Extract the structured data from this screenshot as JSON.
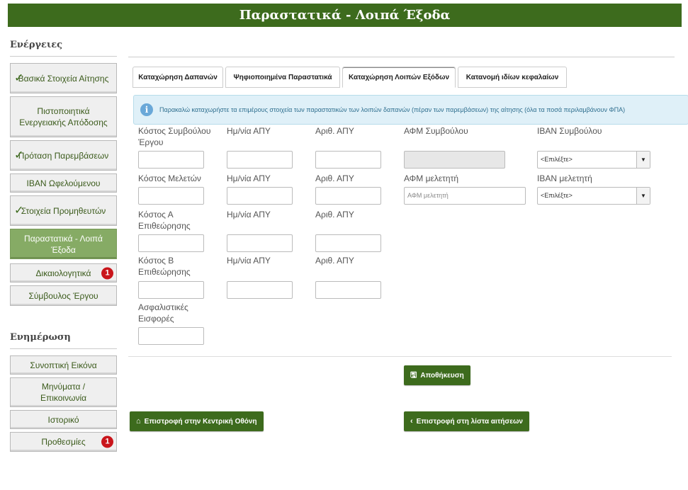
{
  "header": {
    "title": "Παραστατικά - Λοιπά Έξοδα"
  },
  "sidebar": {
    "actions_title": "Ενέργειες",
    "actions": [
      {
        "label": "Βασικά Στοιχεία Αίτησης",
        "checked": true
      },
      {
        "label": "Πιστοποιητικά Ενεργειακής Απόδοσης",
        "checked": false
      },
      {
        "label": "Πρόταση Παρεμβάσεων",
        "checked": true
      },
      {
        "label": "IBAN Ωφελούμενου",
        "checked": false
      },
      {
        "label": "Στοιχεία Προμηθευτών",
        "checked": true
      },
      {
        "label": "Παραστατικά - Λοιπά Έξοδα",
        "active": true
      },
      {
        "label": "Δικαιολογητικά",
        "badge": "1"
      },
      {
        "label": "Σύμβουλος Έργου"
      }
    ],
    "info_title": "Ενημέρωση",
    "info": [
      {
        "label": "Συνοπτική Εικόνα"
      },
      {
        "label": "Μηνύματα / Επικοινωνία"
      },
      {
        "label": "Ιστορικό"
      },
      {
        "label": "Προθεσμίες",
        "badge": "1"
      }
    ]
  },
  "tabs": [
    {
      "label": "Καταχώρηση Δαπανών"
    },
    {
      "label": "Ψηφιοποιημένα Παραστατικά"
    },
    {
      "label": "Καταχώρηση Λοιπών Εξόδων",
      "active": true
    },
    {
      "label": "Κατανομή ιδίων κεφαλαίων"
    }
  ],
  "info_box": {
    "icon": "info-icon",
    "text": "Παρακαλώ καταχωρήστε τα επιμέρους στοιχεία των παραστατικών των λοιπών δαπανών (πέραν των παρεμβάσεων) της αίτησης (όλα τα ποσά περιλαμβάνουν ΦΠΑ)"
  },
  "form": {
    "row1": {
      "cost": "Κόστος Συμβούλου Έργου",
      "date": "Ημ/νία ΑΠΥ",
      "num": "Αριθ. ΑΠΥ",
      "afm": "ΑΦΜ Συμβούλου",
      "iban": "IBAN Συμβούλου",
      "iban_value": "<Επιλέξτε>"
    },
    "row2": {
      "cost": "Κόστος Μελετών",
      "date": "Ημ/νία ΑΠΥ",
      "num": "Αριθ. ΑΠΥ",
      "afm": "ΑΦΜ μελετητή",
      "afm_placeholder": "ΑΦΜ μελετητή",
      "iban": "IBAN μελετητή",
      "iban_value": "<Επιλέξτε>"
    },
    "row3": {
      "cost": "Κόστος Α Επιθεώρησης",
      "date": "Ημ/νία ΑΠΥ",
      "num": "Αριθ. ΑΠΥ"
    },
    "row4": {
      "cost": "Κόστος Β Επιθεώρησης",
      "date": "Ημ/νία ΑΠΥ",
      "num": "Αριθ. ΑΠΥ"
    },
    "row5": {
      "cost": "Ασφαλιστικές Εισφορές"
    }
  },
  "buttons": {
    "save": "Αποθήκευση",
    "home": "Επιστροφή στην Κεντρική Οθόνη",
    "back_list": "Επιστροφή στη λίστα αιτήσεων"
  },
  "colors": {
    "brand_green": "#3d6b1d",
    "active_green": "#86ab65",
    "badge_red": "#c9151b",
    "info_bg": "#dff0f8"
  }
}
